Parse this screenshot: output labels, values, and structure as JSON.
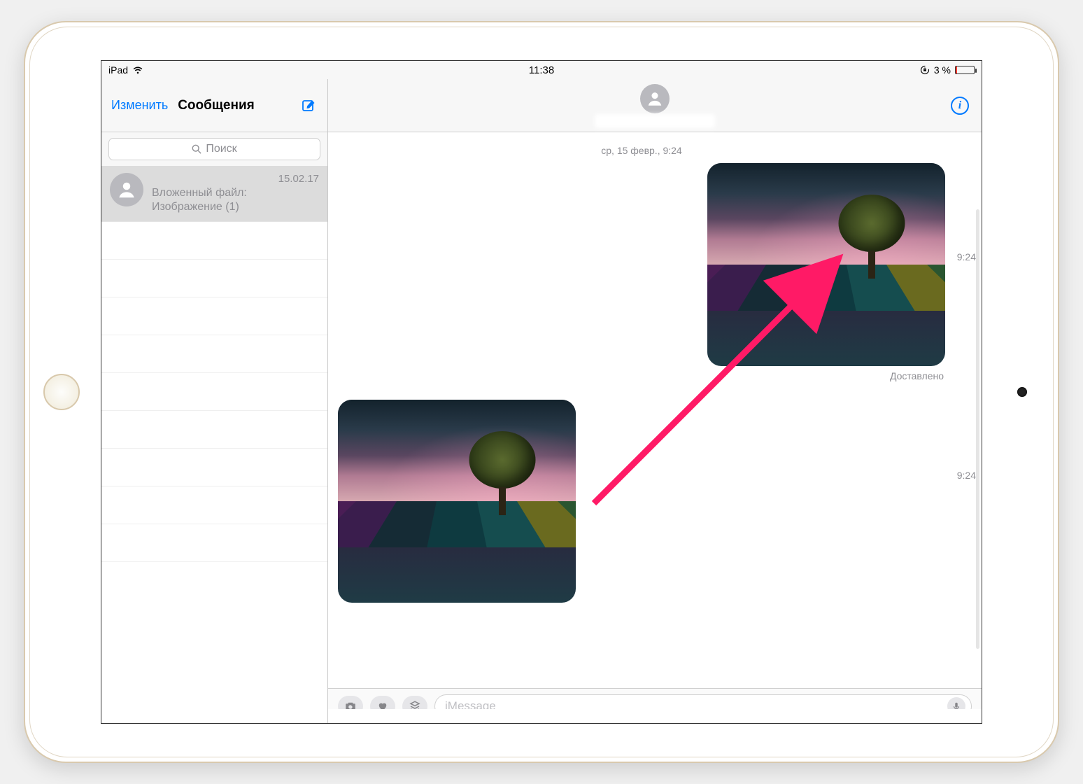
{
  "statusbar": {
    "device": "iPad",
    "time": "11:38",
    "battery_text": "3 %",
    "battery_pct": 3,
    "battery_low": true
  },
  "sidebar": {
    "edit_label": "Изменить",
    "title": "Сообщения",
    "search_placeholder": "Поиск",
    "conversations": [
      {
        "date": "15.02.17",
        "preview_line1": "Вложенный файл:",
        "preview_line2": "Изображение (1)"
      }
    ]
  },
  "thread": {
    "date_separator": "ср, 15 февр., 9:24",
    "messages": [
      {
        "direction": "out",
        "type": "image",
        "timestamp_side": "9:24",
        "delivered_label": "Доставлено"
      },
      {
        "direction": "in",
        "type": "image",
        "timestamp_side": "9:24"
      }
    ],
    "input_placeholder": "iMessage"
  }
}
